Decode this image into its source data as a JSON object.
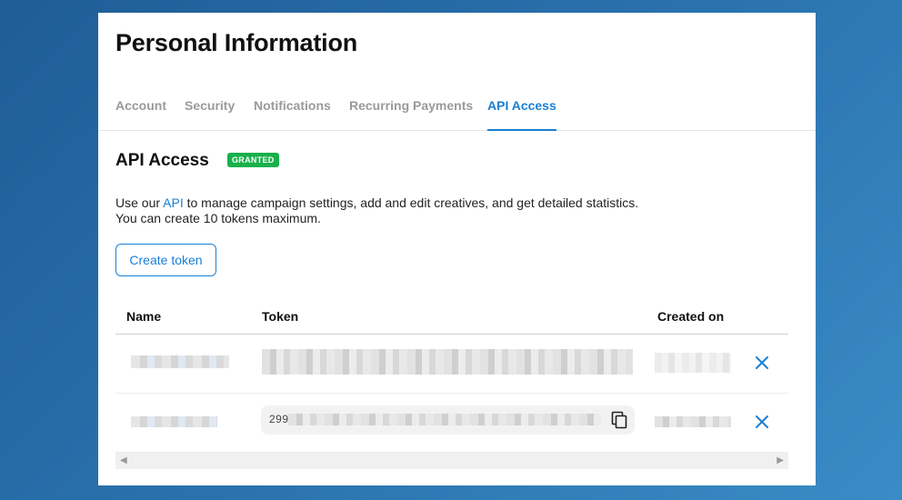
{
  "page": {
    "title": "Personal Information"
  },
  "tabs": [
    {
      "label": "Account",
      "active": false
    },
    {
      "label": "Security",
      "active": false
    },
    {
      "label": "Notifications",
      "active": false
    },
    {
      "label": "Recurring Payments",
      "active": false
    },
    {
      "label": "API Access",
      "active": true
    }
  ],
  "api_section": {
    "title": "API Access",
    "badge": "GRANTED",
    "desc_before_link": "Use our ",
    "desc_link": "API",
    "desc_after_link": " to manage campaign settings, add and edit creatives, and get detailed statistics.",
    "desc_line2": "You can create 10 tokens maximum.",
    "create_button": "Create token"
  },
  "table": {
    "headers": {
      "name": "Name",
      "token": "Token",
      "created_on": "Created on"
    },
    "rows": [
      {
        "name": "[redacted]",
        "token": "[redacted]",
        "created_on": "[redacted]",
        "action_icon": "close-icon"
      },
      {
        "name": "[redacted]",
        "token_prefix": "299",
        "token": "[redacted]",
        "created_on": "[redacted]",
        "copy_icon": "copy-icon",
        "action_icon": "close-icon"
      }
    ]
  },
  "colors": {
    "accent": "#1a7fd4",
    "badge": "#18b04a",
    "background": "#2b74b0"
  }
}
